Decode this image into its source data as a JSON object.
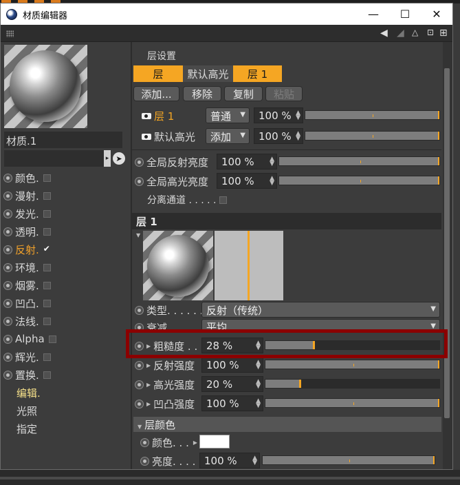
{
  "window": {
    "title": "材质编辑器",
    "minimize": "—",
    "maximize": "☐",
    "close": "✕"
  },
  "toolbar": {
    "arrow_icon": "◀",
    "tri_icon": "◢",
    "lock_icon": "🔒",
    "add_icon": "⊞"
  },
  "material": {
    "name": "材质.1"
  },
  "channels": [
    {
      "label": "颜色.",
      "checked": false
    },
    {
      "label": "漫射.",
      "checked": false
    },
    {
      "label": "发光.",
      "checked": false
    },
    {
      "label": "透明.",
      "checked": false
    },
    {
      "label": "反射.",
      "checked": true,
      "active": true
    },
    {
      "label": "环境.",
      "checked": false
    },
    {
      "label": "烟雾.",
      "checked": false
    },
    {
      "label": "凹凸.",
      "checked": false
    },
    {
      "label": "法线.",
      "checked": false
    },
    {
      "label": "Alpha",
      "checked": false
    },
    {
      "label": "辉光.",
      "checked": false
    },
    {
      "label": "置换.",
      "checked": false
    }
  ],
  "nav": [
    {
      "label": "编辑.",
      "active": true
    },
    {
      "label": "光照",
      "active": false
    },
    {
      "label": "指定",
      "active": false
    }
  ],
  "layer_settings": {
    "title": "层设置",
    "tabs": [
      "层",
      "默认高光",
      "层 1"
    ],
    "buttons": {
      "add": "添加...",
      "remove": "移除",
      "copy": "复制",
      "paste": "粘贴"
    },
    "layers": [
      {
        "name": "层 1",
        "mode": "普通",
        "value": "100 %",
        "percent": 100
      },
      {
        "name": "默认高光",
        "mode": "添加",
        "value": "100 %",
        "percent": 100
      }
    ],
    "global_reflection": {
      "label": "全局反射亮度",
      "value": "100 %",
      "percent": 100
    },
    "global_specular": {
      "label": "全局高光亮度",
      "value": "100 %",
      "percent": 100
    },
    "separate_pass": {
      "label": "分离通道 . . . . .",
      "checked": false
    }
  },
  "layer1": {
    "header": "层 1",
    "type": {
      "label": "类型. . . . . . .",
      "value": "反射（传统）"
    },
    "attenuation": {
      "label": "衰减",
      "value": "平均"
    },
    "roughness": {
      "label": "粗糙度 . .",
      "value": "28 %",
      "percent": 28
    },
    "reflection_strength": {
      "label": "反射强度",
      "value": "100 %",
      "percent": 100
    },
    "specular_strength": {
      "label": "高光强度",
      "value": "20 %",
      "percent": 20
    },
    "bump_strength": {
      "label": "凹凸强度",
      "value": "100 %",
      "percent": 100
    }
  },
  "layer_color": {
    "header": "层颜色",
    "color": {
      "label": "颜色. . .",
      "hex": "#ffffff"
    },
    "brightness": {
      "label": "亮度. . . . .",
      "value": "100 %",
      "percent": 100
    }
  },
  "colors": {
    "accent": "#f5a623",
    "highlight_box": "#8b0000",
    "panel": "#3c3c3c"
  }
}
